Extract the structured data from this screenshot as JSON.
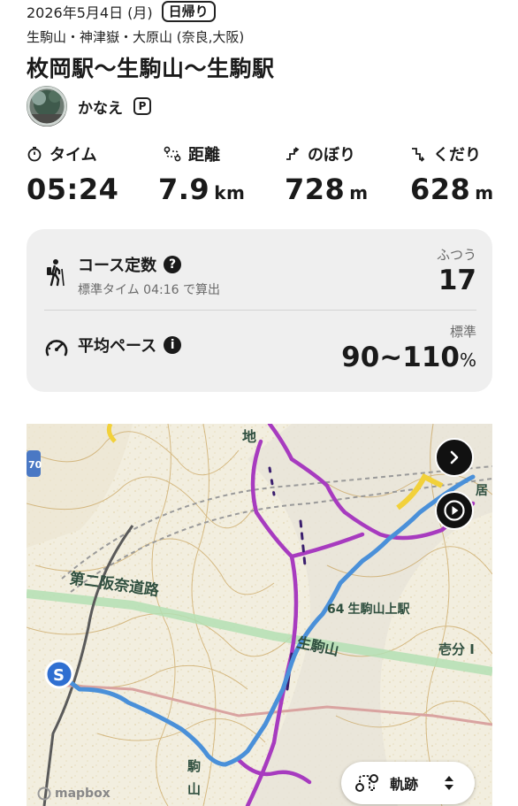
{
  "header": {
    "date": "2026年5月4日 (月)",
    "trip_type": "日帰り",
    "area": "生駒山・神津嶽・大原山 (奈良,大阪)",
    "title": "枚岡駅〜生駒山〜生駒駅"
  },
  "user": {
    "name": "かなえ",
    "badge": "P",
    "avatar_icon": "avatar-photo"
  },
  "stats": [
    {
      "label": "タイム",
      "icon": "stopwatch-icon",
      "value": "05:24",
      "unit": ""
    },
    {
      "label": "距離",
      "icon": "route-icon",
      "value": "7.9",
      "unit": "km"
    },
    {
      "label": "のぼり",
      "icon": "ascent-icon",
      "value": "728",
      "unit": "m"
    },
    {
      "label": "くだり",
      "icon": "descent-icon",
      "value": "628",
      "unit": "m"
    }
  ],
  "course": {
    "title": "コース定数",
    "help": "?",
    "subtitle": "標準タイム 04:16 で算出",
    "caption": "ふつう",
    "value": "17"
  },
  "pace": {
    "title": "平均ペース",
    "info": "i",
    "caption": "標準",
    "value": "90~110",
    "unit": "%"
  },
  "map": {
    "labels": {
      "road": "第二阪奈道路",
      "station": "生駒山上駅",
      "mountain": "生駒山",
      "chi": "地",
      "iki": "壱分 I",
      "koma": "駒",
      "yama": "山",
      "toriii": "居",
      "elev": "64",
      "route_no": "70"
    },
    "start_marker": "S",
    "track_button": "軌跡",
    "attribution": "mapbox",
    "colors": {
      "track": "#4a90d9",
      "trail": "#a73bbf",
      "road": "#a8d8a8",
      "contour": "#c9a35c"
    }
  }
}
